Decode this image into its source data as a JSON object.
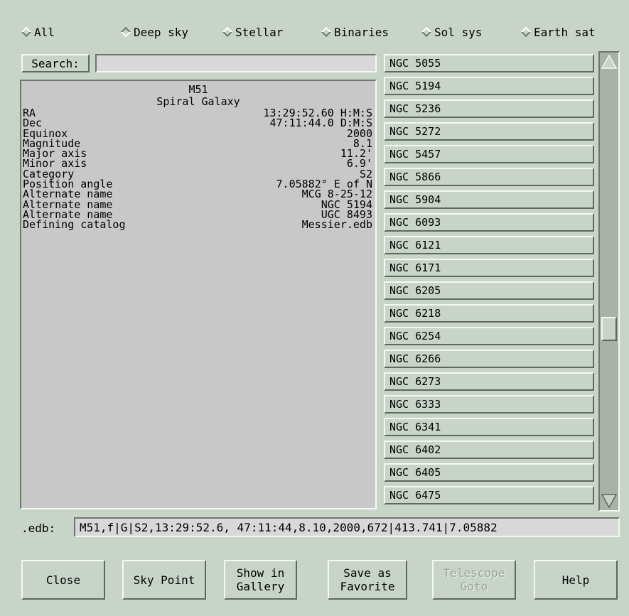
{
  "filters": [
    {
      "label": "All",
      "selected": false
    },
    {
      "label": "Deep sky",
      "selected": true
    },
    {
      "label": "Stellar",
      "selected": false
    },
    {
      "label": "Binaries",
      "selected": false
    },
    {
      "label": "Sol sys",
      "selected": false
    },
    {
      "label": "Earth sat",
      "selected": false
    }
  ],
  "search": {
    "button_label": "Search:",
    "value": ""
  },
  "object": {
    "name": "M51",
    "type": "Spiral Galaxy",
    "fields": [
      {
        "label": "RA",
        "value": "13:29:52.60 H:M:S"
      },
      {
        "label": "Dec",
        "value": "47:11:44.0 D:M:S"
      },
      {
        "label": "Equinox",
        "value": "2000"
      },
      {
        "label": "Magnitude",
        "value": "8.1"
      },
      {
        "label": "Major axis",
        "value": "11.2'"
      },
      {
        "label": "Minor axis",
        "value": "6.9'"
      },
      {
        "label": "Category",
        "value": "S2"
      },
      {
        "label": "Position angle",
        "value": "7.05882° E of N"
      },
      {
        "label": "Alternate name",
        "value": "MCG 8-25-12"
      },
      {
        "label": "Alternate name",
        "value": "NGC 5194"
      },
      {
        "label": "Alternate name",
        "value": "UGC 8493"
      },
      {
        "label": "Defining catalog",
        "value": "Messier.edb"
      }
    ]
  },
  "catalog_list": [
    "NGC 5055",
    "NGC 5194",
    "NGC 5236",
    "NGC 5272",
    "NGC 5457",
    "NGC 5866",
    "NGC 5904",
    "NGC 6093",
    "NGC 6121",
    "NGC 6171",
    "NGC 6205",
    "NGC 6218",
    "NGC 6254",
    "NGC 6266",
    "NGC 6273",
    "NGC 6333",
    "NGC 6341",
    "NGC 6402",
    "NGC 6405",
    "NGC 6475"
  ],
  "scroll_position": 0.62,
  "edb": {
    "label": ".edb:",
    "value": "M51,f|G|S2,13:29:52.6, 47:11:44,8.10,2000,672|413.741|7.05882"
  },
  "buttons": {
    "close": "Close",
    "sky_point": "Sky Point",
    "gallery_line1": "Show in",
    "gallery_line2": "Gallery",
    "favorite_line1": "Save as",
    "favorite_line2": "Favorite",
    "telescope_line1": "Telescope",
    "telescope_line2": "Goto",
    "help": "Help"
  },
  "colors": {
    "background": "#c9d4c9",
    "panel": "#c8c8c8",
    "disabled_text": "#9aa59a"
  }
}
